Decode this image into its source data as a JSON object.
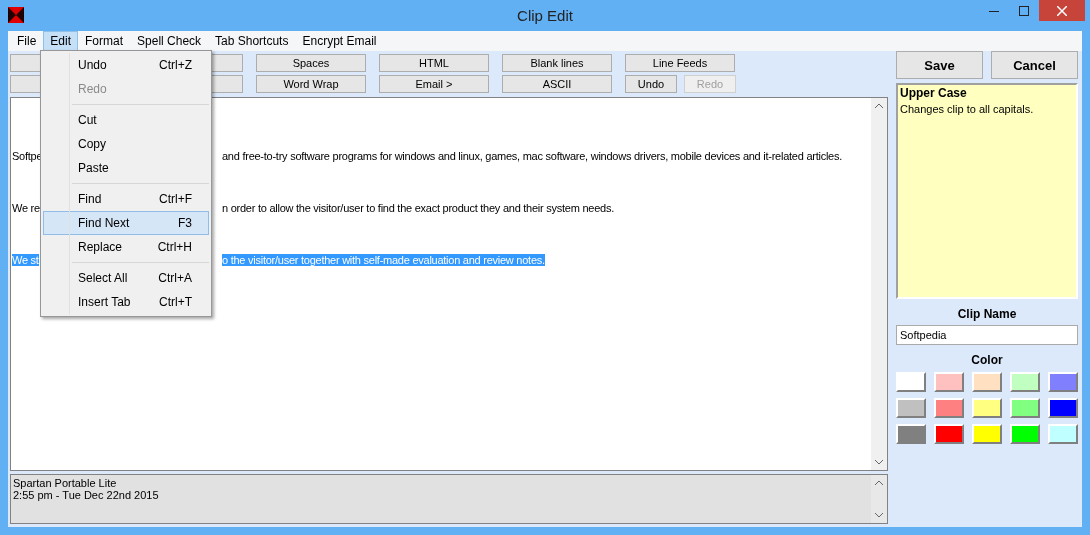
{
  "window": {
    "title": "Clip Edit"
  },
  "menu_bar": [
    {
      "label": "File",
      "selected": false
    },
    {
      "label": "Edit",
      "selected": true
    },
    {
      "label": "Format",
      "selected": false
    },
    {
      "label": "Spell Check",
      "selected": false
    },
    {
      "label": "Tab Shortcuts",
      "selected": false
    },
    {
      "label": "Encrypt Email",
      "selected": false
    }
  ],
  "toolbar_rows": [
    [
      {
        "disabled": false
      },
      {
        "disabled": false
      },
      {
        "label": "Spaces",
        "disabled": false
      },
      {
        "label": "HTML",
        "disabled": false
      },
      {
        "label": "Blank lines",
        "disabled": false
      },
      {
        "label": "Line Feeds",
        "disabled": false
      }
    ],
    [
      {
        "disabled": false
      },
      {
        "disabled": false
      },
      {
        "label": "Word Wrap",
        "disabled": false
      },
      {
        "label": "Email >",
        "disabled": false
      },
      {
        "label": "ASCII",
        "disabled": false
      },
      {
        "label": "Undo",
        "disabled": false,
        "kind": "small"
      },
      {
        "label": "Redo",
        "disabled": true,
        "kind": "small"
      }
    ]
  ],
  "edit_menu": [
    {
      "kind": "item",
      "label": "Undo",
      "shortcut": "Ctrl+Z",
      "disabled": false,
      "selected": false
    },
    {
      "kind": "item",
      "label": "Redo",
      "disabled": true,
      "selected": false
    },
    {
      "kind": "separator"
    },
    {
      "kind": "item",
      "label": "Cut",
      "disabled": false,
      "selected": false
    },
    {
      "kind": "item",
      "label": "Copy",
      "disabled": false,
      "selected": false
    },
    {
      "kind": "item",
      "label": "Paste",
      "disabled": false,
      "selected": false
    },
    {
      "kind": "separator"
    },
    {
      "kind": "item",
      "label": "Find",
      "shortcut": "Ctrl+F",
      "disabled": false,
      "selected": false
    },
    {
      "kind": "item",
      "label": "Find Next",
      "shortcut": "F3",
      "disabled": false,
      "selected": true
    },
    {
      "kind": "item",
      "label": "Replace",
      "shortcut": "Ctrl+H",
      "disabled": false,
      "selected": false
    },
    {
      "kind": "separator"
    },
    {
      "kind": "item",
      "label": "Select All",
      "shortcut": "Ctrl+A",
      "disabled": false,
      "selected": false
    },
    {
      "kind": "item",
      "label": "Insert Tab",
      "shortcut": "Ctrl+T",
      "disabled": false,
      "selected": false
    }
  ],
  "editor": {
    "lines": [
      {
        "visible_start": "Softpe",
        "visible_end": "and free-to-try software programs for windows and linux, games, mac software, windows drivers, mobile devices and it-related articles.",
        "selected": false
      },
      {
        "visible_start": "We re",
        "visible_end": "n order to allow the visitor/user to find the exact product they and their system needs.",
        "selected": false
      },
      {
        "visible_start": "We st",
        "visible_end": "o the visitor/user together with self-made evaluation and review notes.",
        "selected": true
      }
    ]
  },
  "status_box": [
    "Spartan Portable Lite",
    "2:55 pm - Tue Dec 22nd  2015"
  ],
  "side_panel": {
    "buttons": [
      "Save",
      "Cancel"
    ],
    "help_title": "Upper Case",
    "help_text": "Changes clip to all capitals.",
    "clip_name_label": "Clip Name",
    "clip_name_value": "Softpedia",
    "color_label": "Color",
    "colors": [
      {
        "color": "#ffffff"
      },
      {
        "color": "#ffc0c0"
      },
      {
        "color": "#ffe0c0"
      },
      {
        "color": "#c0ffc0"
      },
      {
        "color": "#8080ff"
      },
      {
        "color": "#c0c0c0"
      },
      {
        "color": "#ff8080"
      },
      {
        "color": "#ffff80"
      },
      {
        "color": "#80ff80"
      },
      {
        "color": "#0000ff"
      },
      {
        "color": "#808080"
      },
      {
        "color": "#ff0000"
      },
      {
        "color": "#ffff00"
      },
      {
        "color": "#00ff00"
      },
      {
        "color": "#c0ffff"
      }
    ]
  }
}
